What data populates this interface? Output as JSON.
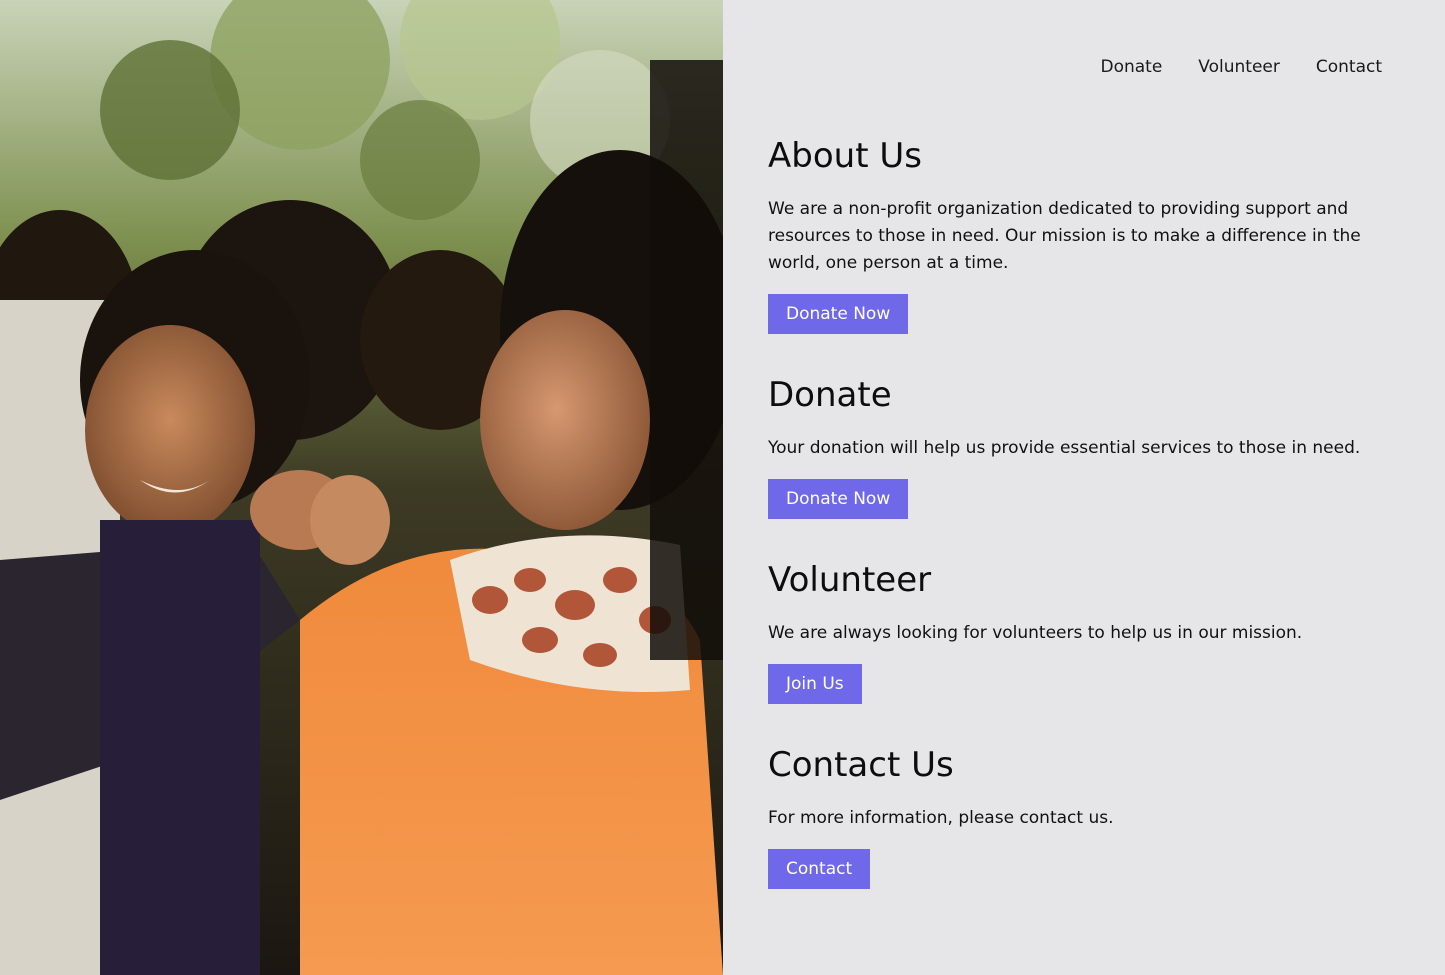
{
  "nav": {
    "items": [
      "Donate",
      "Volunteer",
      "Contact"
    ]
  },
  "sections": [
    {
      "title": "About Us",
      "text": "We are a non-profit organization dedicated to providing support and resources to those in need. Our mission is to make a difference in the world, one person at a time.",
      "button": "Donate Now"
    },
    {
      "title": "Donate",
      "text": "Your donation will help us provide essential services to those in need.",
      "button": "Donate Now"
    },
    {
      "title": "Volunteer",
      "text": "We are always looking for volunteers to help us in our mission.",
      "button": "Join Us"
    },
    {
      "title": "Contact Us",
      "text": "For more information, please contact us.",
      "button": "Contact"
    }
  ],
  "colors": {
    "background": "#e6e6e9",
    "button": "#6f68e8",
    "button_text": "#ffffff"
  }
}
